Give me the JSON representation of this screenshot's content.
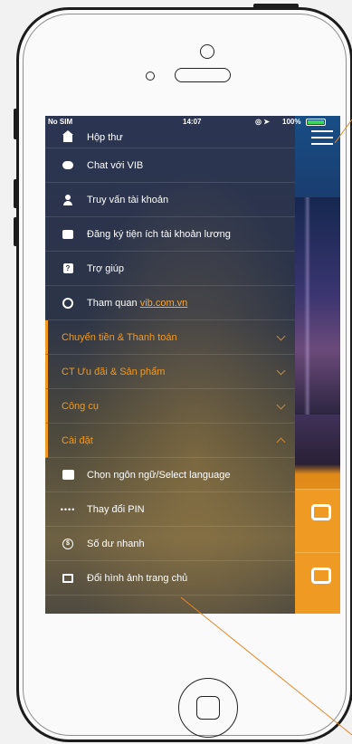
{
  "status_bar": {
    "carrier": "No SIM",
    "time": "14:07",
    "battery": "100%"
  },
  "menu": {
    "items": [
      {
        "icon": "house-icon",
        "label": "Hộp thư"
      },
      {
        "icon": "chat-icon",
        "label": "Chat với VIB"
      },
      {
        "icon": "user-icon",
        "label": "Truy vấn tài khoản"
      },
      {
        "icon": "card-icon",
        "label": "Đăng ký tiện ích tài khoản lương"
      },
      {
        "icon": "help-icon",
        "label": "Trợ giúp"
      },
      {
        "icon": "globe-icon",
        "label": "Tham quan",
        "link": "vib.com.vn"
      }
    ],
    "sections": [
      {
        "label": "Chuyển tiền & Thanh toán",
        "expanded": false
      },
      {
        "label": "CT Ưu đãi & Sản phẩm",
        "expanded": false
      },
      {
        "label": "Công cụ",
        "expanded": false
      },
      {
        "label": "Cài đặt",
        "expanded": true
      }
    ],
    "settings_items": [
      {
        "icon": "language-icon",
        "label": "Chọn ngôn ngữ/Select language"
      },
      {
        "icon": "pin-dots-icon",
        "label": "Thay đổi PIN"
      },
      {
        "icon": "dollar-icon",
        "label": "Số dư nhanh"
      },
      {
        "icon": "image-icon",
        "label": "Đổi hình ảnh trang chủ"
      }
    ]
  },
  "colors": {
    "accent": "#f29a1f",
    "drawer_top": "#2b3552",
    "header_blue": "#174e86"
  }
}
